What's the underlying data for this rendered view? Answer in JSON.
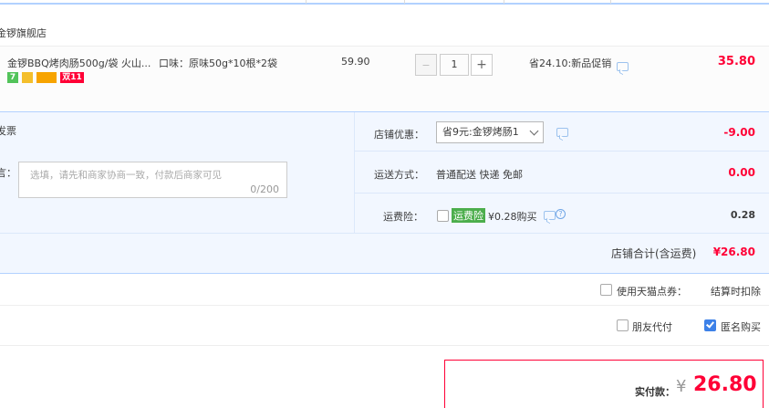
{
  "store": {
    "name": "金锣旗舰店"
  },
  "item": {
    "title": "金锣BBQ烤肉肠500g/袋 火山...",
    "spec": "口味：原味50g*10根*2袋",
    "unit_price": "59.90",
    "quantity": "1",
    "minus": "−",
    "plus": "+",
    "discount_note": "省24.10:新品促销",
    "subtotal": "35.80",
    "badges": [
      "7",
      "双11"
    ]
  },
  "invoice": {
    "label": "发票"
  },
  "message": {
    "label": "言：",
    "placeholder": "选填，请先和商家协商一致，付款后商家可见",
    "counter": "0/200"
  },
  "promotion": {
    "label": "店铺优惠：",
    "selected": "省9元:金锣烤肠1",
    "amount": "-9.00"
  },
  "shipping": {
    "label": "运送方式：",
    "method": "普通配送 快递 免邮",
    "amount": "0.00"
  },
  "insurance": {
    "label": "运费险：",
    "tag": "运费险",
    "desc": "¥0.28购买",
    "amount": "0.28"
  },
  "store_total": {
    "label": "店铺合计(含运费)",
    "amount": "¥26.80"
  },
  "points": {
    "label": "使用天猫点券：",
    "note": "结算时扣除"
  },
  "options": {
    "friend_pay": "朋友代付",
    "anonymous": "匿名购买"
  },
  "payment": {
    "label": "实付款：",
    "currency": "¥",
    "amount": "26.80"
  },
  "colors": {
    "accent_red": "#ff0036",
    "panel_bg": "#f2f7ff",
    "border_blue": "#b2d1ff",
    "check_blue": "#3d81e8"
  }
}
